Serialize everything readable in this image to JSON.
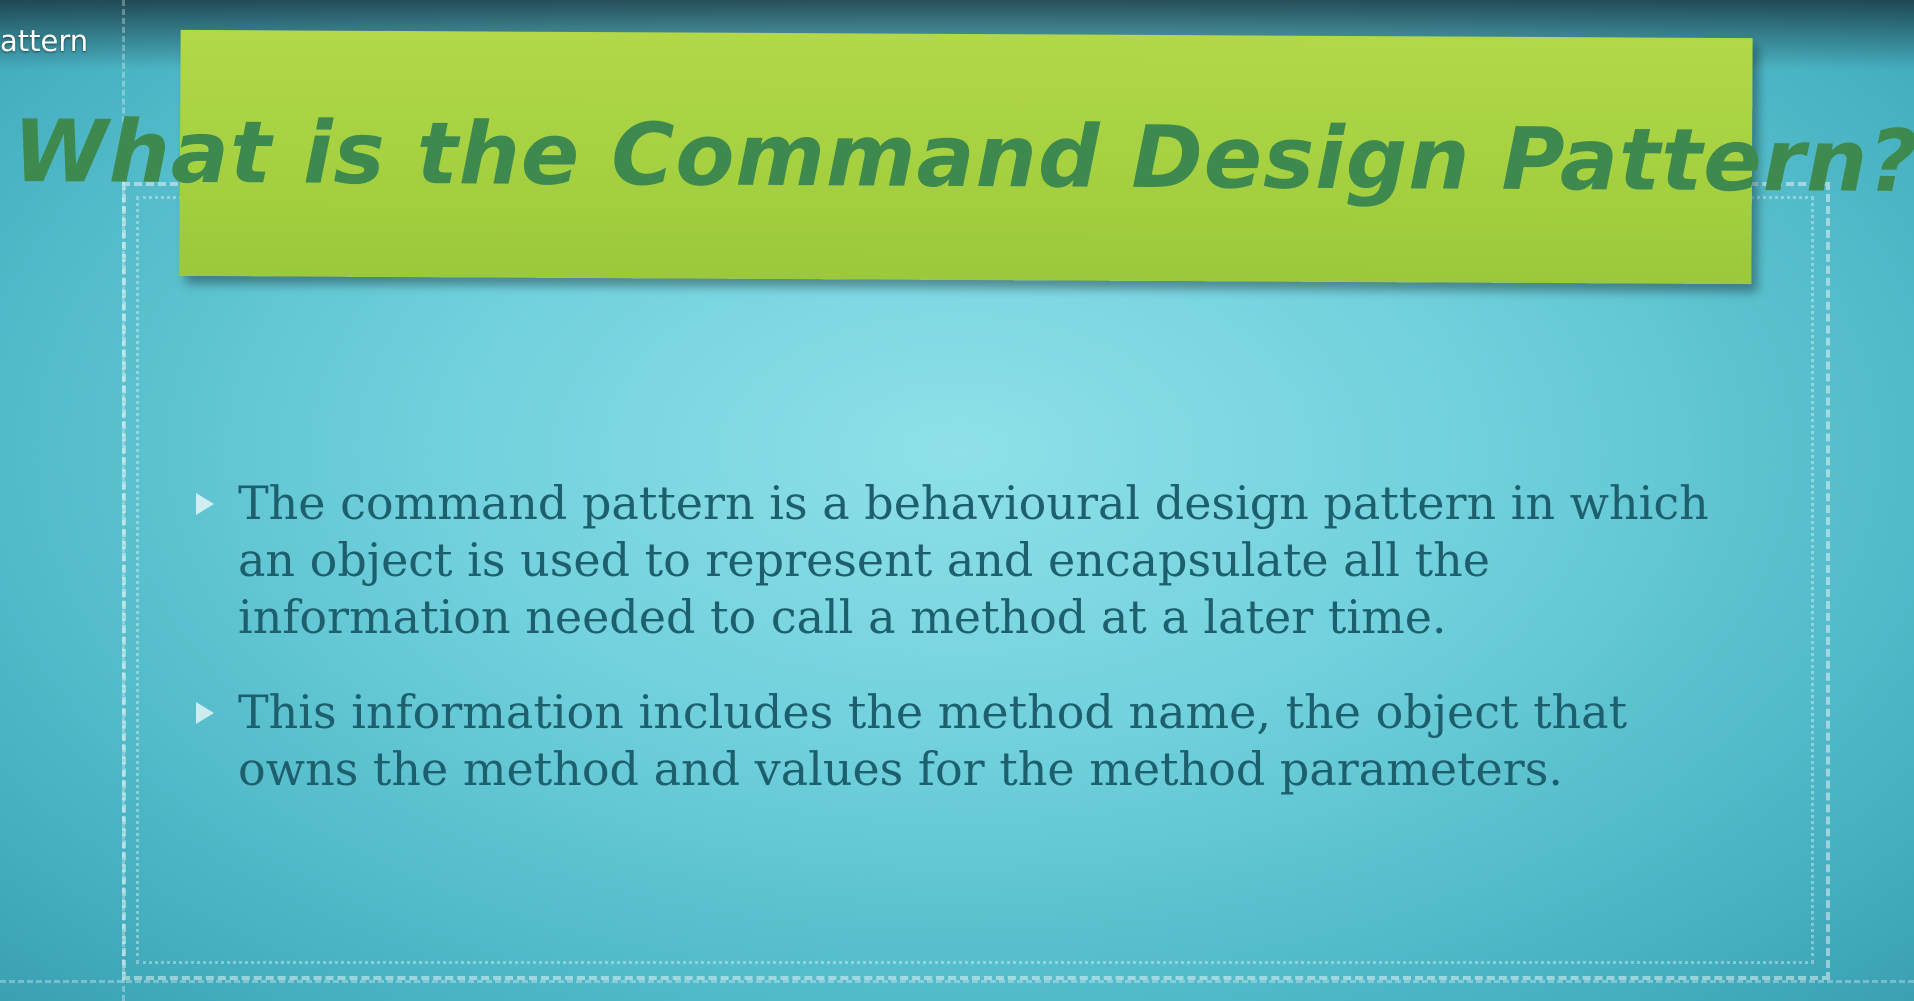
{
  "video": {
    "title_fragment": "attern"
  },
  "slide": {
    "title": "What is the Command Design Pattern?",
    "bullets": [
      {
        "text": "The command pattern is a behavioural design pattern in which an object is used to represent and encapsulate all the information needed to call a method at a later time."
      },
      {
        "text": "This information includes the method name, the object that owns the method and values for the method parameters."
      }
    ]
  },
  "colors": {
    "background": "#6fd0dc",
    "banner": "#a4d040",
    "title_text": "#3e8a4e",
    "body_text": "#1e5f6e"
  }
}
